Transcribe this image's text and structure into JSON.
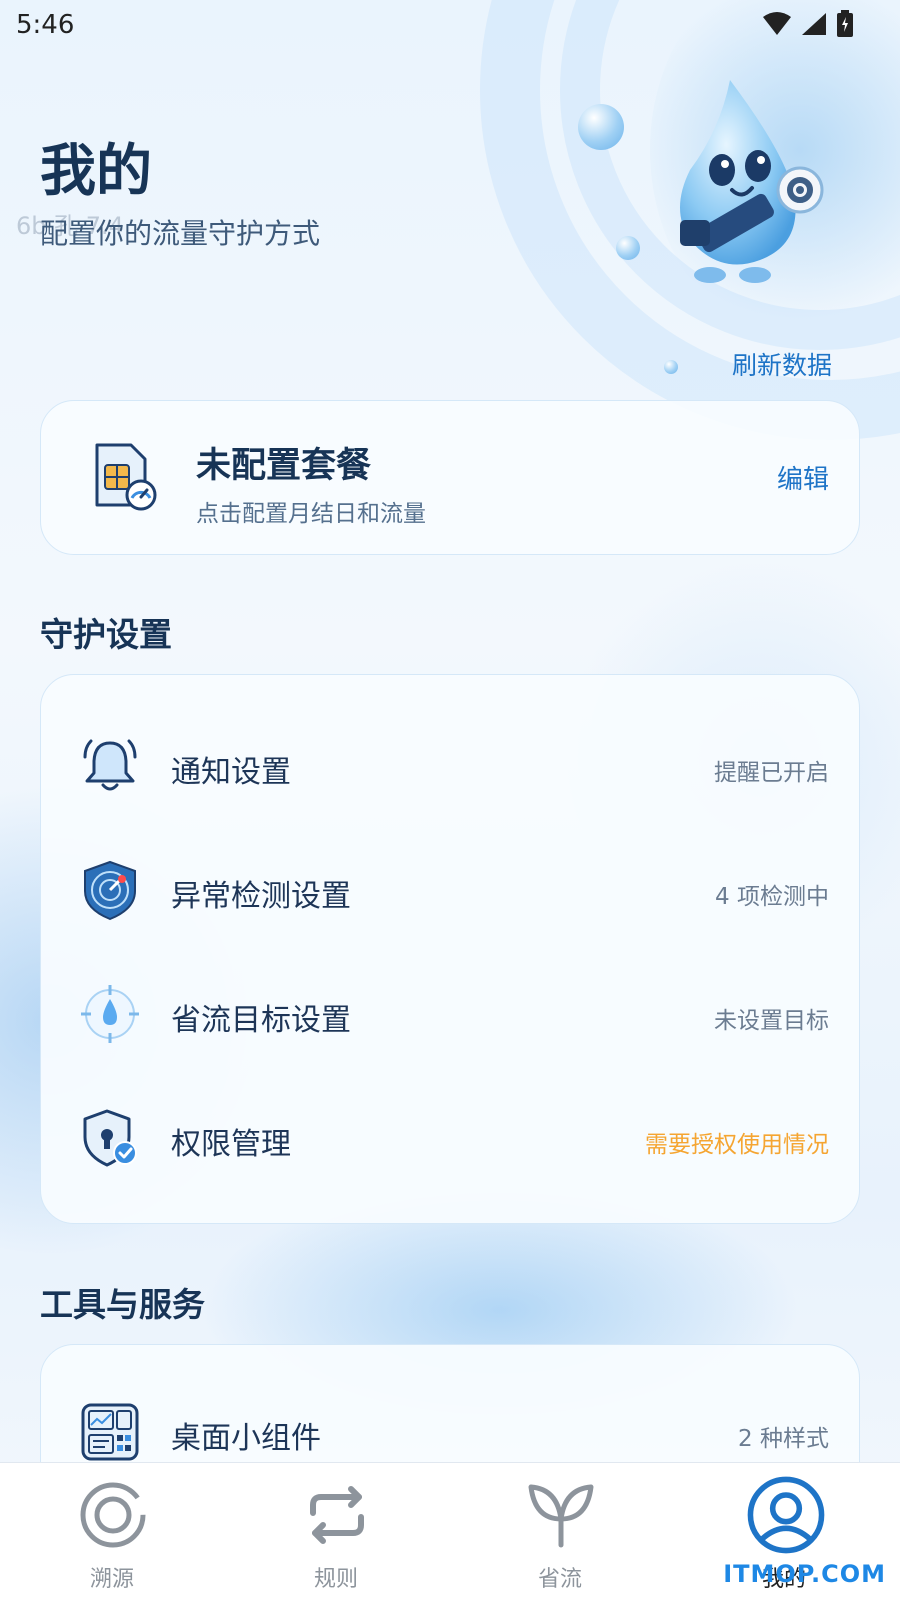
{
  "status_bar": {
    "time": "5:46"
  },
  "header": {
    "title": "我的",
    "ghost_text": "6b 孔 7.4",
    "subtitle": "配置你的流量守护方式",
    "refresh_label": "刷新数据"
  },
  "plan_card": {
    "title": "未配置套餐",
    "description": "点击配置月结日和流量",
    "edit_label": "编辑"
  },
  "settings_section": {
    "title": "守护设置",
    "items": [
      {
        "label": "通知设置",
        "status": "提醒已开启",
        "icon": "bell-icon"
      },
      {
        "label": "异常检测设置",
        "status": "4 项检测中",
        "icon": "radar-icon"
      },
      {
        "label": "省流目标设置",
        "status": "未设置目标",
        "icon": "target-drop-icon"
      },
      {
        "label": "权限管理",
        "status": "需要授权使用情况",
        "icon": "shield-lock-icon"
      }
    ]
  },
  "tools_section": {
    "title": "工具与服务",
    "items": [
      {
        "label": "桌面小组件",
        "status": "2 种样式",
        "icon": "widget-icon"
      }
    ]
  },
  "bottom_nav": {
    "items": [
      {
        "label": "溯源",
        "icon": "trace-icon"
      },
      {
        "label": "规则",
        "icon": "rules-icon"
      },
      {
        "label": "省流",
        "icon": "sprout-icon"
      },
      {
        "label": "我的",
        "icon": "profile-icon"
      }
    ],
    "active": "我的"
  },
  "watermark": "ITMOP.COM",
  "colors": {
    "accent": "#1e74c7",
    "title": "#173456",
    "warning": "#f5a531",
    "muted": "#6b7c91"
  }
}
